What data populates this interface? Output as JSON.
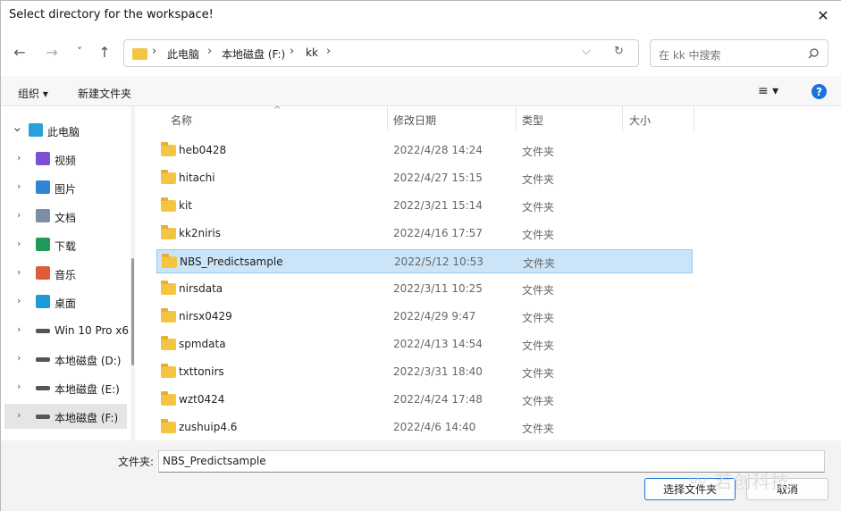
{
  "window": {
    "title": "Select directory for the workspace!",
    "close_glyph": "✕"
  },
  "nav": {
    "back": "←",
    "forward": "→",
    "recent": "˅",
    "up": "↑",
    "refresh": "↻",
    "expand": "⌵",
    "breadcrumb": [
      "此电脑",
      "本地磁盘 (F:)",
      "kk"
    ],
    "search_placeholder": "在 kk 中搜索"
  },
  "toolbar": {
    "organize": "组织 ▾",
    "new_folder": "新建文件夹",
    "view_glyph": "≡ ▾",
    "help": "?"
  },
  "sidebar": [
    {
      "label": "此电脑",
      "icon": "monitor-icon",
      "expanded": true
    },
    {
      "label": "视频",
      "icon": "video-icon"
    },
    {
      "label": "图片",
      "icon": "picture-icon"
    },
    {
      "label": "文档",
      "icon": "document-icon"
    },
    {
      "label": "下载",
      "icon": "download-icon"
    },
    {
      "label": "音乐",
      "icon": "music-icon"
    },
    {
      "label": "桌面",
      "icon": "desktop-icon"
    },
    {
      "label": "Win 10 Pro x6",
      "icon": "drive-icon"
    },
    {
      "label": "本地磁盘 (D:)",
      "icon": "drive-icon"
    },
    {
      "label": "本地磁盘 (E:)",
      "icon": "drive-icon"
    },
    {
      "label": "本地磁盘 (F:)",
      "icon": "drive-icon",
      "selected": true
    }
  ],
  "columns": {
    "name": "名称",
    "date": "修改日期",
    "type": "类型",
    "size": "大小",
    "sort_glyph": "^"
  },
  "files": [
    {
      "name": "heb0428",
      "date": "2022/4/28 14:24",
      "type": "文件夹"
    },
    {
      "name": "hitachi",
      "date": "2022/4/27 15:15",
      "type": "文件夹"
    },
    {
      "name": "kit",
      "date": "2022/3/21 15:14",
      "type": "文件夹"
    },
    {
      "name": "kk2niris",
      "date": "2022/4/16 17:57",
      "type": "文件夹"
    },
    {
      "name": "NBS_Predictsample",
      "date": "2022/5/12 10:53",
      "type": "文件夹",
      "selected": true
    },
    {
      "name": "nirsdata",
      "date": "2022/3/11 10:25",
      "type": "文件夹"
    },
    {
      "name": "nirsx0429",
      "date": "2022/4/29 9:47",
      "type": "文件夹"
    },
    {
      "name": "spmdata",
      "date": "2022/4/13 14:54",
      "type": "文件夹"
    },
    {
      "name": "txttonirs",
      "date": "2022/3/31 18:40",
      "type": "文件夹"
    },
    {
      "name": "wzt0424",
      "date": "2022/4/24 17:48",
      "type": "文件夹"
    },
    {
      "name": "zushuip4.6",
      "date": "2022/4/6 14:40",
      "type": "文件夹"
    }
  ],
  "footer": {
    "folder_label": "文件夹:",
    "folder_value": "NBS_Predictsample",
    "ok": "选择文件夹",
    "cancel": "取消"
  },
  "watermark": "〰 若创科技",
  "colors": {
    "accent": "#1a73d9",
    "selection": "#cce4f7",
    "folder": "#f4c542"
  }
}
